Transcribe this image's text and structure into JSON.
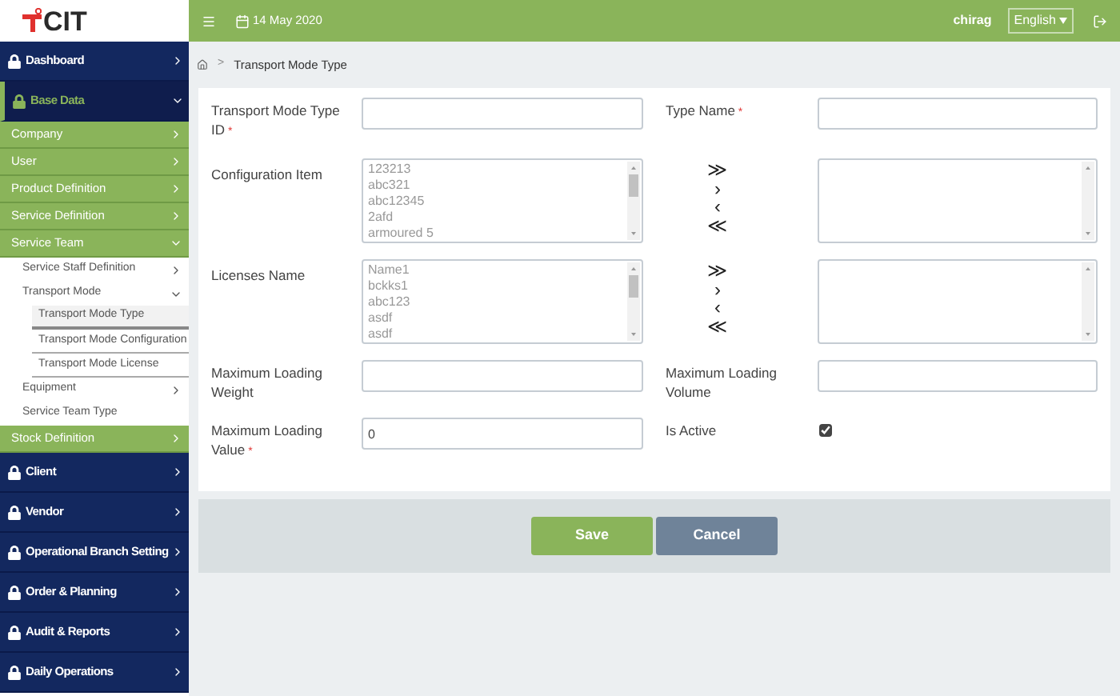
{
  "logo": {
    "text": "CIT"
  },
  "sidebar": {
    "items": [
      {
        "label": "Dashboard",
        "expanded": false
      },
      {
        "label": "Base Data",
        "expanded": true,
        "children": [
          {
            "label": "Company",
            "expanded": false
          },
          {
            "label": "User",
            "expanded": false
          },
          {
            "label": "Product Definition",
            "expanded": false
          },
          {
            "label": "Service Definition",
            "expanded": false
          },
          {
            "label": "Service Team",
            "expanded": true,
            "children": [
              {
                "label": "Service Staff Definition",
                "expanded": false
              },
              {
                "label": "Transport Mode",
                "expanded": true,
                "children": [
                  {
                    "label": "Transport Mode Type",
                    "selected": true
                  },
                  {
                    "label": "Transport Mode Configuration",
                    "selected": false
                  },
                  {
                    "label": "Transport Mode License",
                    "selected": false
                  }
                ]
              },
              {
                "label": "Equipment",
                "expanded": false
              },
              {
                "label": "Service Team Type"
              }
            ]
          },
          {
            "label": "Stock Definition",
            "expanded": false
          }
        ]
      },
      {
        "label": "Client",
        "expanded": false
      },
      {
        "label": "Vendor",
        "expanded": false
      },
      {
        "label": "Operational Branch Setting",
        "expanded": false
      },
      {
        "label": "Order & Planning",
        "expanded": false
      },
      {
        "label": "Audit & Reports",
        "expanded": false
      },
      {
        "label": "Daily Operations",
        "expanded": false
      }
    ]
  },
  "topbar": {
    "date": "14 May 2020",
    "user": "chirag",
    "language": "English"
  },
  "breadcrumb": {
    "separator": ">",
    "current": "Transport Mode Type"
  },
  "form": {
    "rows": [
      {
        "kind": "pair",
        "left": {
          "label": "Transport Mode Type ID",
          "required_mark": "*"
        },
        "right": {
          "label": "Type Name",
          "required_mark": "*"
        }
      },
      {
        "kind": "transfer",
        "label": "Configuration Item",
        "available": [
          "123213",
          "abc321",
          "abc12345",
          "2afd",
          "armoured 5"
        ],
        "chosen": [],
        "buttons": [
          "≫",
          "›",
          "‹",
          "≪"
        ]
      },
      {
        "kind": "transfer",
        "label": "Licenses Name",
        "available": [
          "Name1",
          "bckks1",
          "abc123",
          "asdf",
          "asdf"
        ],
        "chosen": [],
        "buttons": [
          "≫",
          "›",
          "‹",
          "≪"
        ]
      },
      {
        "kind": "pair",
        "left": {
          "label": "Maximum Loading Weight"
        },
        "right": {
          "label": "Maximum Loading Volume"
        }
      },
      {
        "kind": "pair",
        "left": {
          "label": "Maximum Loading Value",
          "required_mark": "*",
          "value": "0"
        },
        "right": {
          "label": "Is Active",
          "kind": "checkbox",
          "checked": true
        }
      }
    ]
  },
  "buttons": [
    {
      "label": "Save",
      "kind": "primary"
    },
    {
      "label": "Cancel",
      "kind": "secondary"
    }
  ]
}
